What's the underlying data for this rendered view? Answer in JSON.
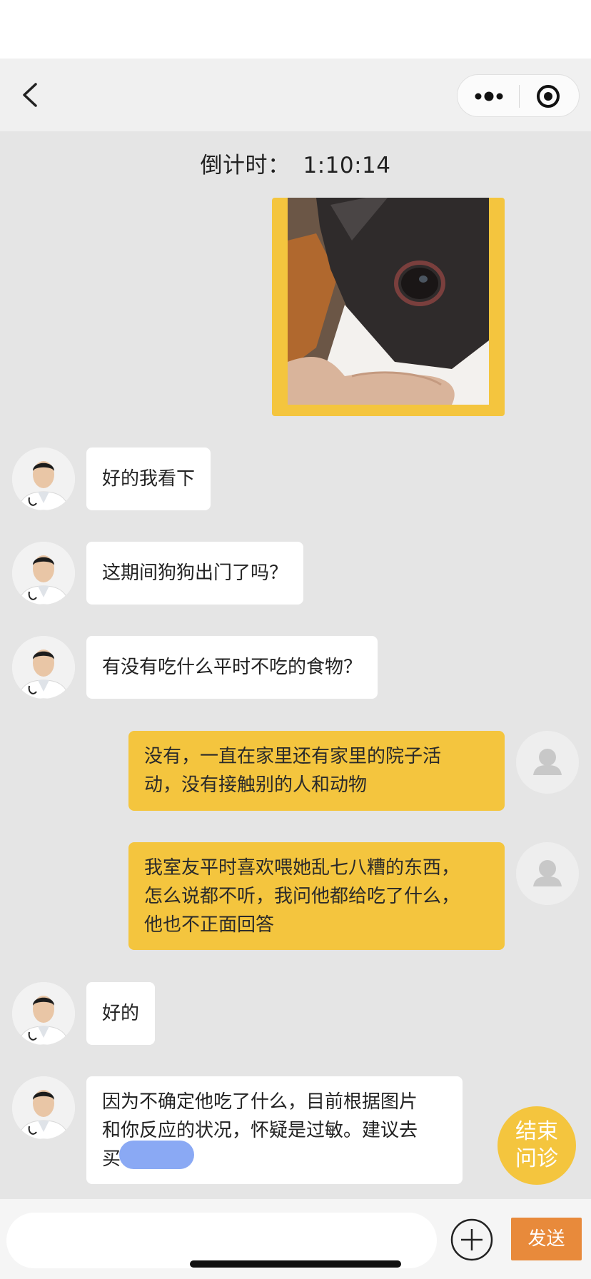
{
  "countdown": {
    "label": "倒计时：",
    "time": "1:10:14"
  },
  "messages": [
    {
      "side": "doctor",
      "text": "好的我看下"
    },
    {
      "side": "doctor",
      "text": "这期间狗狗出门了吗？"
    },
    {
      "side": "doctor",
      "text": "有没有吃什么平时不吃的食物？"
    },
    {
      "side": "user",
      "lines": [
        "没有，一直在家里还有家里的院子活",
        "动，没有接触别的人和动物"
      ]
    },
    {
      "side": "user",
      "lines": [
        "我室友平时喜欢喂她乱七八糟的东西，",
        "怎么说都不听，我问他都给吃了什么，",
        "他也不正面回答"
      ]
    },
    {
      "side": "doctor",
      "text": "好的"
    },
    {
      "side": "doctor",
      "lines": [
        "因为不确定他吃了什么，目前根据图片",
        "和你反应的状况，怀疑是过敏。建议去",
        "买"
      ]
    }
  ],
  "end_button": {
    "line1": "结束",
    "line2": "问诊"
  },
  "input": {
    "value": "",
    "placeholder": ""
  },
  "send_label": "发送",
  "icons": {
    "back": "chevron-left-icon",
    "more": "more-dots-icon",
    "target": "record-target-icon",
    "plus": "plus-circle-icon",
    "avatar_user": "person-silhouette-icon"
  },
  "colors": {
    "accent_yellow": "#f4c53e",
    "send_orange": "#e88a3b",
    "mask_blue": "#8aa9f4",
    "background": "#e5e5e5"
  }
}
